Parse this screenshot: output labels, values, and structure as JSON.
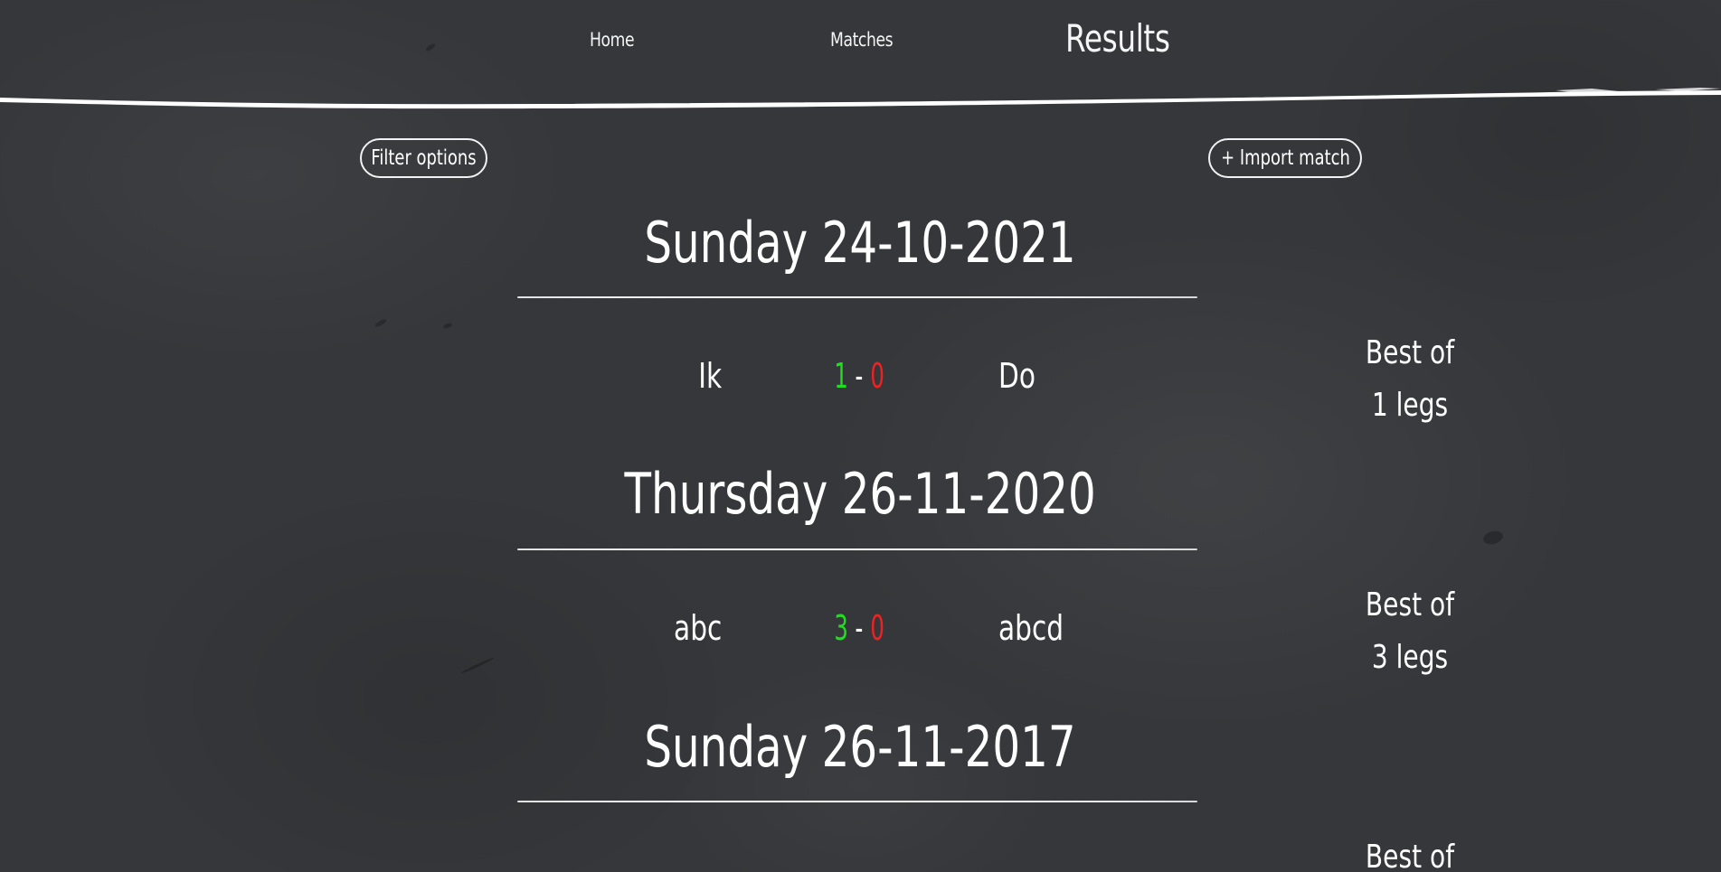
{
  "nav": {
    "home_label": "Home",
    "matches_label": "Matches",
    "results_label": "Results"
  },
  "toolbar": {
    "filter_label": "Filter options",
    "import_label": "+ Import match"
  },
  "days": [
    {
      "heading": "Sunday 24-10-2021",
      "match": {
        "home": "Ik",
        "home_score": "1",
        "separator": "-",
        "away_score": "0",
        "away": "Do",
        "best_of_line1": "Best of",
        "best_of_line2": "1 legs"
      }
    },
    {
      "heading": "Thursday 26-11-2020",
      "match": {
        "home": "abc",
        "home_score": "3",
        "separator": "-",
        "away_score": "0",
        "away": "abcd",
        "best_of_line1": "Best of",
        "best_of_line2": "3 legs"
      }
    },
    {
      "heading": "Sunday 26-11-2017",
      "match": {
        "best_of_line1": "Best of"
      }
    }
  ],
  "colors": {
    "background": "#35373a",
    "text": "#ffffff",
    "winner_score": "#22dd22",
    "loser_score": "#ee2222"
  }
}
